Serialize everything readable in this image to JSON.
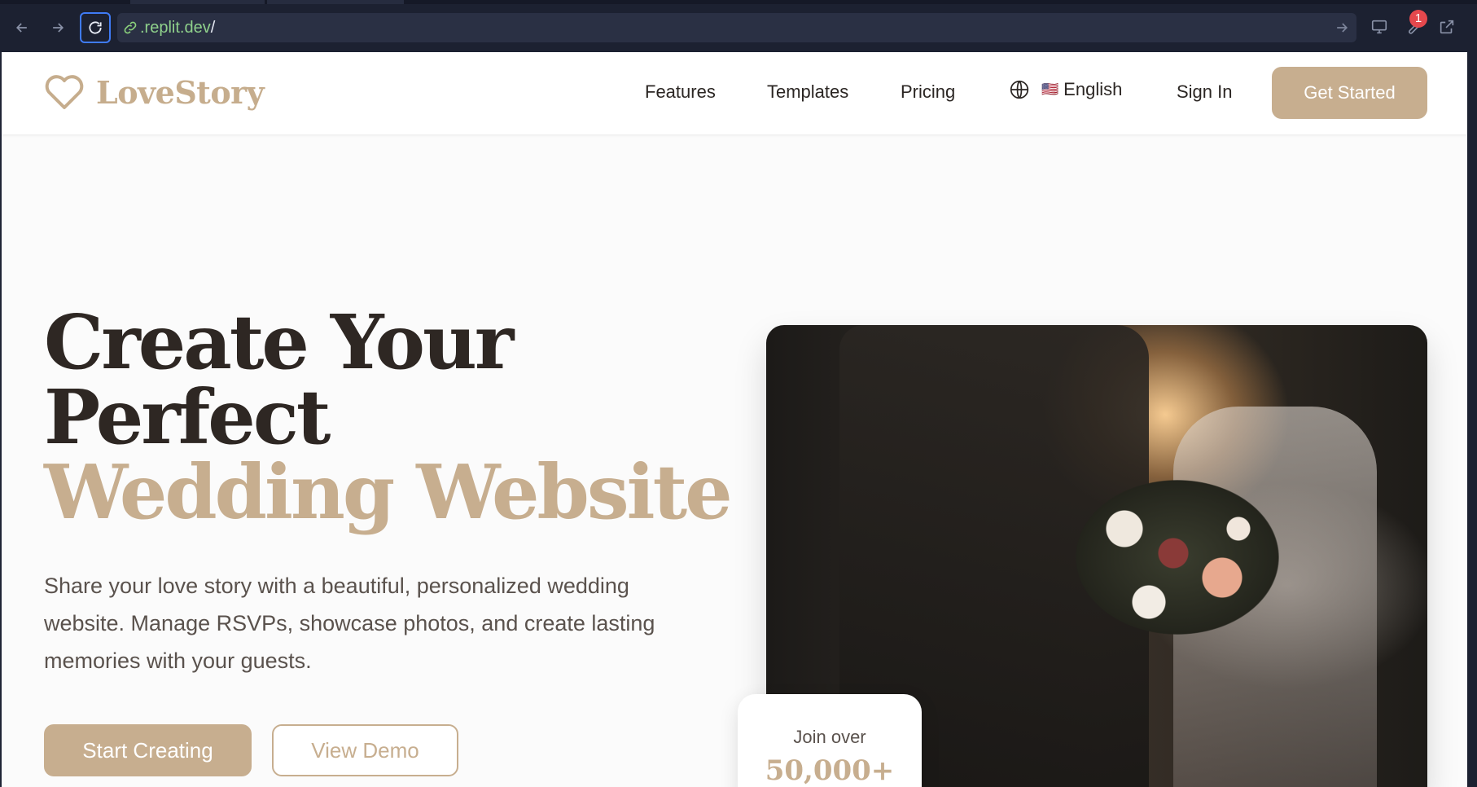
{
  "browser": {
    "url_host": ".replit.dev",
    "url_path": "/",
    "notification_count": "1"
  },
  "header": {
    "logo_text": "LoveStory",
    "nav": {
      "features": "Features",
      "templates": "Templates",
      "pricing": "Pricing",
      "language": "English",
      "language_flag": "🇺🇸",
      "sign_in": "Sign In"
    },
    "cta": "Get Started"
  },
  "hero": {
    "title_line1": "Create Your",
    "title_line2": "Perfect",
    "title_accent": "Wedding Website",
    "subtitle": "Share your love story with a beautiful, personalized wedding website. Manage RSVPs, showcase photos, and create lasting memories with your guests.",
    "primary_button": "Start Creating",
    "secondary_button": "View Demo"
  },
  "stat_card": {
    "label": "Join over",
    "value": "50,000+"
  },
  "colors": {
    "accent": "#c7ae8f",
    "heading": "#2e2723",
    "body_text": "#5a524d",
    "url_green": "#8fd18b",
    "focus_blue": "#3f7bf5",
    "badge_red": "#e5484d"
  },
  "icons": {
    "back": "arrow-left-icon",
    "forward": "arrow-right-icon",
    "reload": "reload-icon",
    "link": "link-icon",
    "go": "arrow-right-icon",
    "devices": "monitor-icon",
    "tools": "wrench-icon",
    "external": "external-link-icon",
    "logo": "heart-icon",
    "language": "globe-icon"
  }
}
